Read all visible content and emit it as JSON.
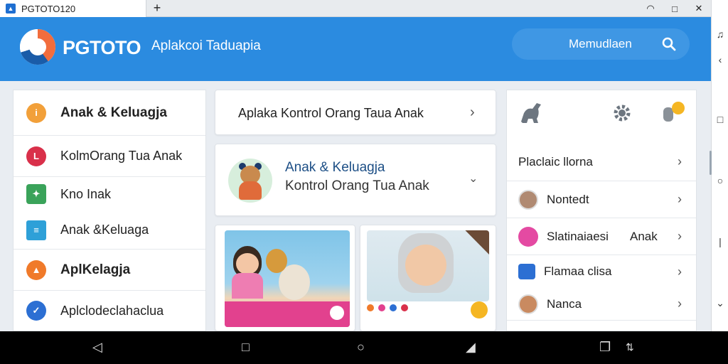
{
  "titlebar": {
    "tab_title": "PGTOTO120",
    "new_tab": "+",
    "wifi": "◠",
    "maximize": "□",
    "close": "✕"
  },
  "header": {
    "brand": "PGTOTO",
    "subtitle": "Aplakcoi Taduapia",
    "search_label": "Memudlaen"
  },
  "left_menu": [
    {
      "label": "Anak & Keluagja",
      "icon": "info-icon",
      "color": "#f2a03a",
      "bold": true
    },
    {
      "label": "KolmOrang Tua Anak",
      "icon": "clock-icon",
      "color": "#d9304a",
      "bold": false
    },
    {
      "label": "Kno Inak",
      "icon": "puzzle-icon",
      "color": "#3aa35a",
      "bold": false
    },
    {
      "label": "Anak &Keluaga",
      "icon": "list-icon",
      "color": "#2ea0d8",
      "bold": false
    },
    {
      "label": "AplKelagja",
      "icon": "cat-icon",
      "color": "#f07a2a",
      "bold": true
    },
    {
      "label": "Aplclodeclahaclua",
      "icon": "location-icon",
      "color": "#2c6fd3",
      "bold": false
    }
  ],
  "middle": {
    "top_card": "Aplaka Kontrol Orang Taua Anak",
    "feature_title": "Anak & Keluagja",
    "feature_subtitle": "Kontrol Orang Tua Anak"
  },
  "right_panel": {
    "icons": [
      "dinosaur-icon",
      "gear-icon",
      "mic-icon"
    ],
    "items": [
      {
        "label": "Placlaic llorna",
        "avatar": "none",
        "extra": ""
      },
      {
        "label": "Nontedt",
        "avatar": "person-avatar",
        "extra": ""
      },
      {
        "label": "Slatinaiaesi",
        "avatar": "flower-icon",
        "extra": "Anak"
      },
      {
        "label": "Flamaa clisa",
        "avatar": "image-icon",
        "extra": ""
      },
      {
        "label": "Nanca",
        "avatar": "child-avatar",
        "extra": ""
      }
    ]
  },
  "colors": {
    "header": "#2b8be0",
    "search": "#3f97e4",
    "accent": "#f26d3d"
  }
}
